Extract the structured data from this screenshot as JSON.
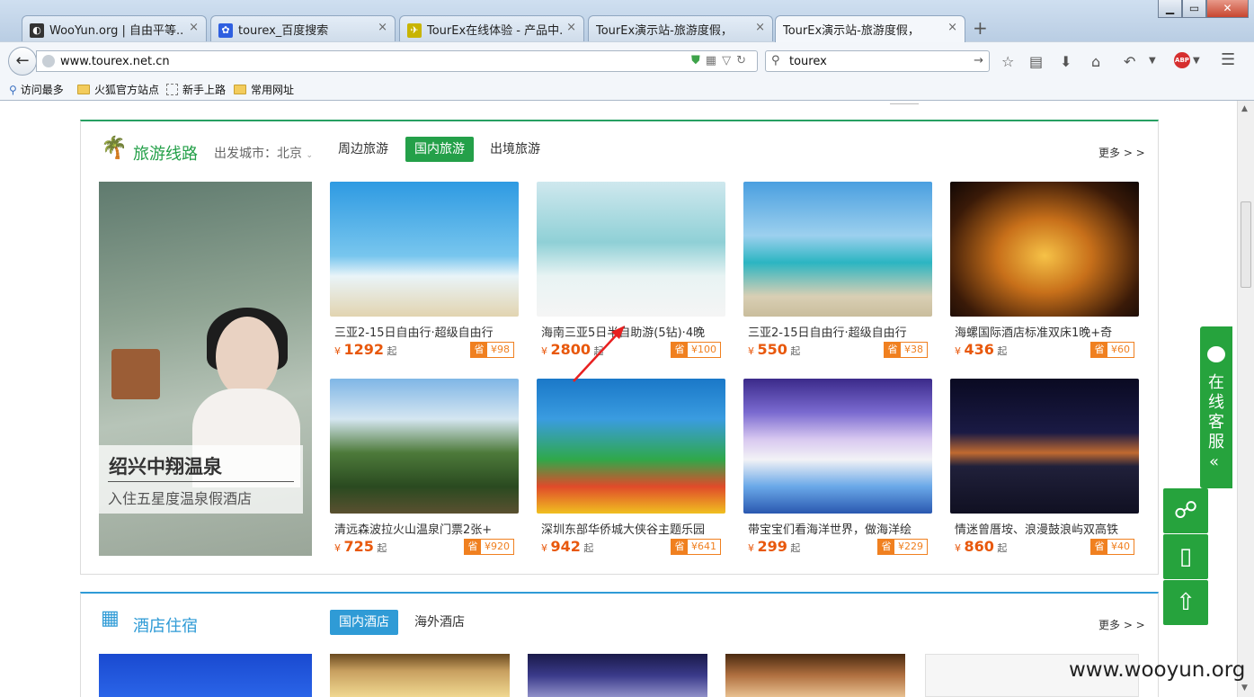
{
  "browser": {
    "tabs": [
      {
        "title": "WooYun.org | 自由平等...",
        "icon_color": "#333333"
      },
      {
        "title": "tourex_百度搜索",
        "icon_color": "#2e5fe0"
      },
      {
        "title": "TourEx在线体验 - 产品中...",
        "icon_color": "#c8b400"
      },
      {
        "title": "TourEx演示站-旅游度假，酒..."
      },
      {
        "title": "TourEx演示站-旅游度假，酒..."
      }
    ],
    "tab_close": "×",
    "new_tab": "+",
    "url": "www.tourex.net.cn",
    "search_query": "tourex",
    "abp_label": "ABP",
    "bookmarks": [
      "访问最多",
      "火狐官方站点",
      "新手上路",
      "常用网址"
    ]
  },
  "travel": {
    "title": "旅游线路",
    "departure": "出发城市：北京",
    "tabs": [
      "周边旅游",
      "国内旅游",
      "出境旅游"
    ],
    "more": "更多 > >",
    "promo": {
      "title": "绍兴中翔温泉",
      "subtitle": "入住五星度温泉假酒店"
    },
    "cards": [
      {
        "name": "三亚2-15日自由行·超级自由行",
        "price": "1292",
        "save": "¥98"
      },
      {
        "name": "海南三亚5日半自助游(5钻)·4晚",
        "price": "2800",
        "save": "¥100"
      },
      {
        "name": "三亚2-15日自由行·超级自由行",
        "price": "550",
        "save": "¥38"
      },
      {
        "name": "海螺国际酒店标准双床1晚+奇",
        "price": "436",
        "save": "¥60"
      },
      {
        "name": "清远森波拉火山温泉门票2张+",
        "price": "725",
        "save": "¥920"
      },
      {
        "name": "深圳东部华侨城大侠谷主题乐园",
        "price": "942",
        "save": "¥641"
      },
      {
        "name": "带宝宝们看海洋世界，做海洋绘",
        "price": "299",
        "save": "¥229"
      },
      {
        "name": "情迷曾厝垵、浪漫鼓浪屿双高铁",
        "price": "860",
        "save": "¥40"
      }
    ],
    "currency": "¥",
    "from_label": "起",
    "save_label": "省"
  },
  "hotel": {
    "title": "酒店住宿",
    "tabs": [
      "国内酒店",
      "海外酒店"
    ],
    "more": "更多 > >"
  },
  "service": {
    "label": "在线客服",
    "chevron": "«"
  },
  "watermark": "www.wooyun.org",
  "colors": {
    "brand_green": "#24a049",
    "price_orange": "#e8580c",
    "hotel_blue": "#2f9bd6"
  }
}
